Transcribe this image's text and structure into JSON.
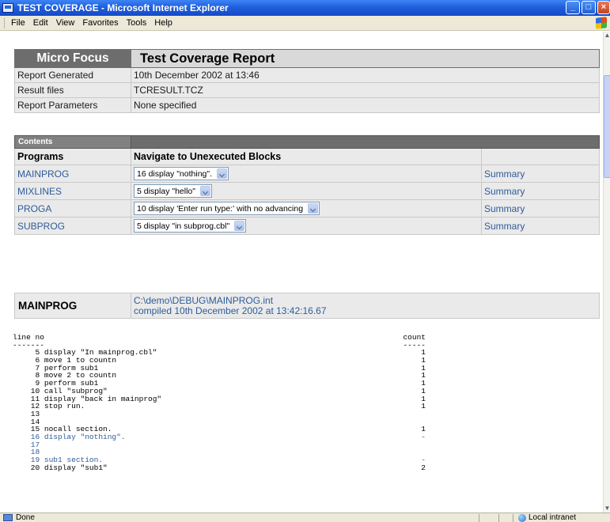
{
  "window": {
    "title": "TEST COVERAGE - Microsoft Internet Explorer",
    "menu": [
      "File",
      "Edit",
      "View",
      "Favorites",
      "Tools",
      "Help"
    ]
  },
  "report": {
    "brand": "Micro Focus",
    "title": "Test Coverage Report",
    "meta": [
      {
        "label": "Report Generated",
        "value": "10th December 2002 at 13:46"
      },
      {
        "label": "Result files",
        "value": "TCRESULT.TCZ"
      },
      {
        "label": "Report Parameters",
        "value": "None specified"
      }
    ]
  },
  "contents": {
    "label": "Contents",
    "col_programs": "Programs",
    "col_navigate": "Navigate to Unexecuted Blocks",
    "programs": [
      {
        "name": "MAINPROG",
        "block": "16 display \"nothing\".",
        "summary": "Summary"
      },
      {
        "name": "MIXLINES",
        "block": "5 display \"hello\"",
        "summary": "Summary"
      },
      {
        "name": "PROGA",
        "block": "10 display 'Enter run type:' with no advancing",
        "summary": "Summary"
      },
      {
        "name": "SUBPROG",
        "block": "5 display \"in subprog.cbl\"",
        "summary": "Summary"
      }
    ]
  },
  "program_section": {
    "name": "MAINPROG",
    "path": "C:\\demo\\DEBUG\\MAINPROG.int",
    "compiled": "compiled 10th December 2002 at 13:42:16.67"
  },
  "listing": {
    "rows": [
      {
        "code": "line no",
        "count": "count",
        "color": "black"
      },
      {
        "code": "-------",
        "count": "-----",
        "color": "black"
      },
      {
        "code": "     5 display \"In mainprog.cbl\"",
        "count": "1",
        "color": "black"
      },
      {
        "code": "     6 move 1 to countn",
        "count": "1",
        "color": "black"
      },
      {
        "code": "     7 perform sub1",
        "count": "1",
        "color": "black"
      },
      {
        "code": "     8 move 2 to countn",
        "count": "1",
        "color": "black"
      },
      {
        "code": "     9 perform sub1",
        "count": "1",
        "color": "black"
      },
      {
        "code": "    10 call \"subprog\"",
        "count": "1",
        "color": "black"
      },
      {
        "code": "    11 display \"back in mainprog\"",
        "count": "1",
        "color": "black"
      },
      {
        "code": "    12 stop run.",
        "count": "1",
        "color": "black"
      },
      {
        "code": "    13",
        "count": "",
        "color": "black"
      },
      {
        "code": "    14",
        "count": "",
        "color": "black"
      },
      {
        "code": "    15 nocall section.",
        "count": "1",
        "color": "black"
      },
      {
        "code": "    16 display \"nothing\".",
        "count": "-",
        "color": "blue"
      },
      {
        "code": "    17",
        "count": "",
        "color": "blue"
      },
      {
        "code": "    18",
        "count": "",
        "color": "blue"
      },
      {
        "code": "    19 sub1 section.",
        "count": "-",
        "color": "blue"
      },
      {
        "code": "    20 display \"sub1\"",
        "count": "2",
        "color": "black"
      }
    ]
  },
  "status": {
    "text": "Done",
    "zone": "Local intranet"
  },
  "colors": {
    "header_gray": "#6d6d6d",
    "row_gray": "#eaeaea",
    "link_blue": "#2e5c9a"
  }
}
